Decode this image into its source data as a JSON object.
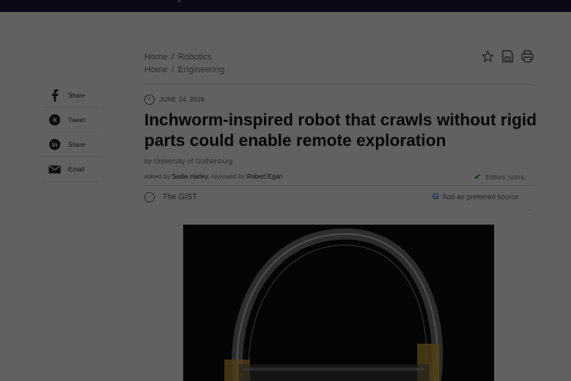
{
  "share": {
    "items": [
      {
        "icon": "facebook-icon",
        "label": "Share"
      },
      {
        "icon": "x-twitter-icon",
        "label": "Tweet"
      },
      {
        "icon": "linkedin-icon",
        "label": "Share"
      },
      {
        "icon": "email-icon",
        "label": "Email"
      }
    ]
  },
  "breadcrumbs": {
    "row1": [
      "Home",
      "Robotics"
    ],
    "row2": [
      "Home",
      "Engineering"
    ],
    "separator": "/"
  },
  "tools": [
    "star-icon",
    "save-icon",
    "print-icon"
  ],
  "article": {
    "date": "JUNE 24, 2026",
    "title": "Inchworm-inspired robot that crawls without rigid parts could enable remote exploration",
    "byline": "by University of Gothenburg",
    "edited_prefix": "edited by",
    "editor": "Sadie Harley",
    "reviewed_prefix": ", reviewed by",
    "reviewer": "Robert Egan",
    "editors_notes": "Editors' notes",
    "gist": "The GIST",
    "preferred_source": "Add as preferred source"
  },
  "colors": {
    "topbar": "#1a1a3e",
    "overlay": "rgba(0,0,0,0.62)",
    "check": "#2a8a2a",
    "google_blue": "#4285f4"
  }
}
